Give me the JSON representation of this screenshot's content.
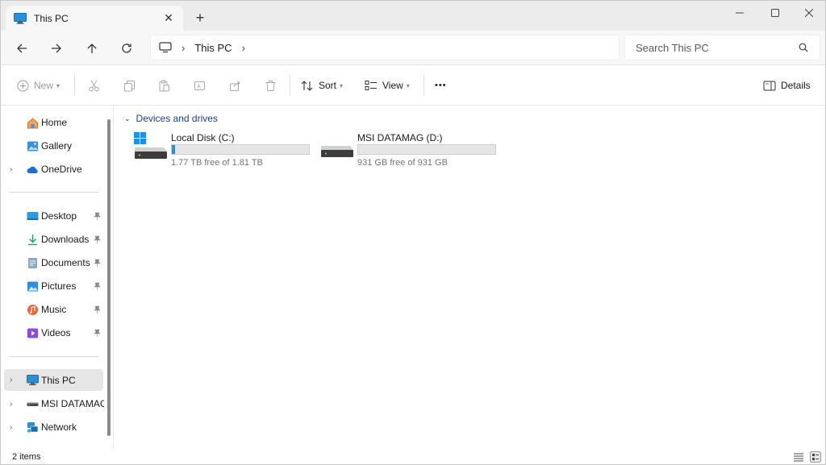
{
  "window": {
    "tab_title": "This PC",
    "new_tab_symbol": "+",
    "close_tab_symbol": "✕"
  },
  "navigation": {
    "breadcrumb": [
      "This PC"
    ],
    "search_placeholder": "Search This PC"
  },
  "toolbar": {
    "new_label": "New",
    "sort_label": "Sort",
    "view_label": "View",
    "more_label": "•••",
    "details_label": "Details"
  },
  "sidebar": {
    "quick": [
      {
        "label": "Home",
        "icon": "home-icon"
      },
      {
        "label": "Gallery",
        "icon": "gallery-icon"
      },
      {
        "label": "OneDrive",
        "icon": "onedrive-icon",
        "expandable": true
      }
    ],
    "pinned": [
      {
        "label": "Desktop",
        "icon": "desktop-icon",
        "pinned": true
      },
      {
        "label": "Downloads",
        "icon": "downloads-icon",
        "pinned": true
      },
      {
        "label": "Documents",
        "icon": "documents-icon",
        "pinned": true
      },
      {
        "label": "Pictures",
        "icon": "pictures-icon",
        "pinned": true
      },
      {
        "label": "Music",
        "icon": "music-icon",
        "pinned": true
      },
      {
        "label": "Videos",
        "icon": "videos-icon",
        "pinned": true
      }
    ],
    "locations": [
      {
        "label": "This PC",
        "icon": "this-pc-icon",
        "selected": true
      },
      {
        "label": "MSI DATAMAG (",
        "icon": "drive-icon"
      },
      {
        "label": "Network",
        "icon": "network-icon"
      }
    ]
  },
  "content": {
    "group_title": "Devices and drives",
    "drives": [
      {
        "name": "Local Disk (C:)",
        "free_text": "1.77 TB free of 1.81 TB",
        "used_fraction": 0.022,
        "system": true
      },
      {
        "name": "MSI DATAMAG (D:)",
        "free_text": "931 GB free of 931 GB",
        "used_fraction": 0.0,
        "system": false
      }
    ]
  },
  "status": {
    "item_count": "2 items"
  },
  "colors": {
    "accent": "#2d8fd8",
    "folder_blue": "#1f6fd1",
    "group_header": "#1f3f8a"
  }
}
